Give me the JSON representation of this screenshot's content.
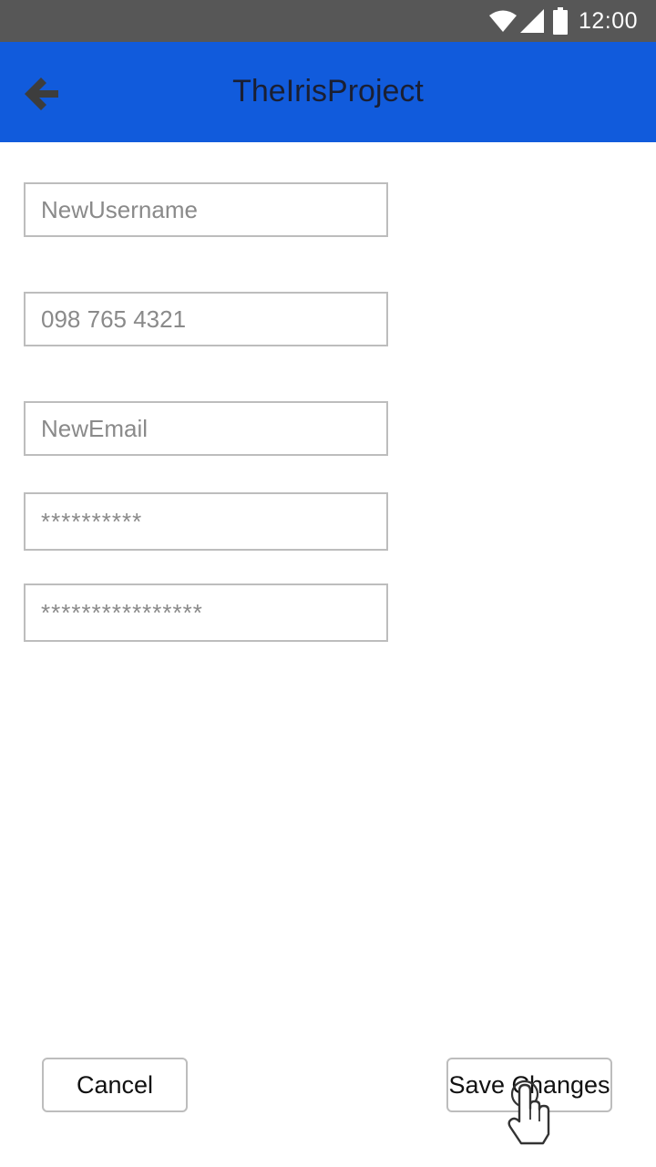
{
  "status_bar": {
    "time": "12:00",
    "icons": [
      "wifi-icon",
      "cell-signal-icon",
      "battery-icon"
    ]
  },
  "app_bar": {
    "title": "TheIrisProject",
    "back_icon": "arrow-left-icon",
    "background_color": "#115bdc"
  },
  "form": {
    "username": {
      "placeholder": "NewUsername"
    },
    "phone": {
      "placeholder": "098 765 4321"
    },
    "email": {
      "placeholder": "NewEmail"
    },
    "password": {
      "placeholder": "**********"
    },
    "password_confirm": {
      "placeholder": "****************"
    }
  },
  "actions": {
    "cancel_label": "Cancel",
    "save_label": "Save Changes"
  },
  "cursor": {
    "icon": "hand-pointer-icon"
  }
}
